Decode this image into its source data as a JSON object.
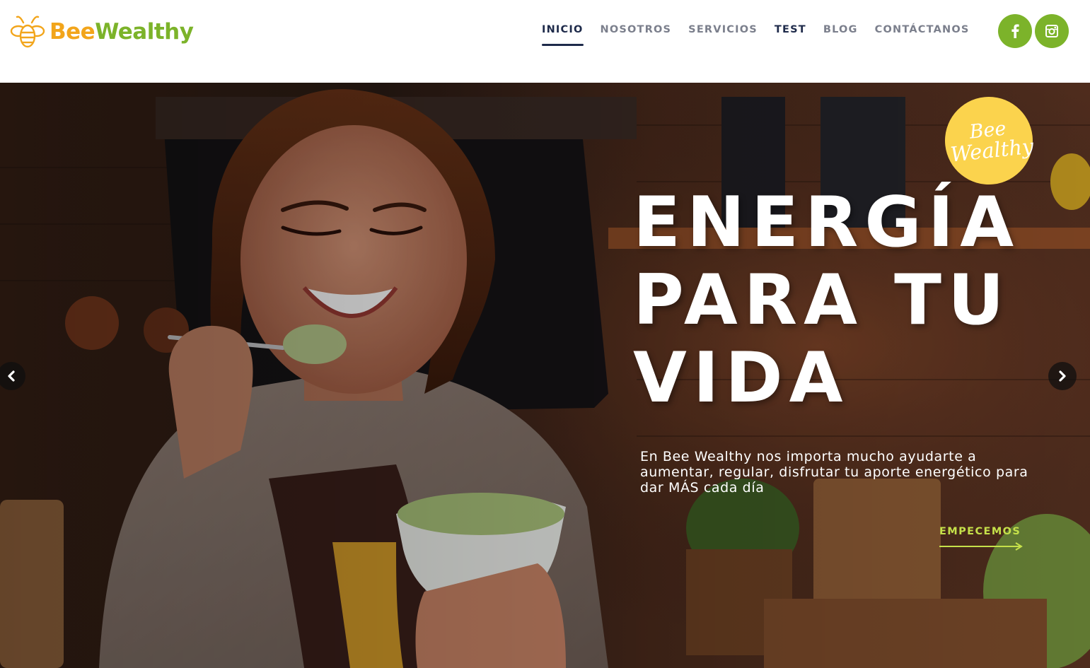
{
  "brand": {
    "name_part1": "Bee",
    "name_part2": "Wealthy",
    "logo_icon": "bee-icon",
    "colors": {
      "orange": "#f2a51b",
      "green": "#7cb32a",
      "navy": "#1e2a4a"
    }
  },
  "nav": {
    "items": [
      {
        "label": "INICIO",
        "active": true
      },
      {
        "label": "NOSOTROS"
      },
      {
        "label": "SERVICIOS"
      },
      {
        "label": "TEST"
      },
      {
        "label": "BLOG"
      },
      {
        "label": "CONTÁCTANOS"
      }
    ]
  },
  "social": {
    "facebook_icon": "facebook-icon",
    "instagram_icon": "instagram-icon"
  },
  "hero": {
    "badge_line1": "Bee",
    "badge_line2": "Wealthy",
    "headline_line1": "ENERGÍA",
    "headline_line2": "PARA TU",
    "headline_line3": "VIDA",
    "subtitle": "En Bee Wealthy nos importa mucho ayudarte a aumentar, regular, disfrutar tu aporte energético para dar MÁS cada día",
    "cta_label": "EMPECEMOS",
    "cta_color": "#c5e04a",
    "badge_color": "#fbd34d",
    "prev_icon": "chevron-left-icon",
    "next_icon": "chevron-right-icon"
  }
}
